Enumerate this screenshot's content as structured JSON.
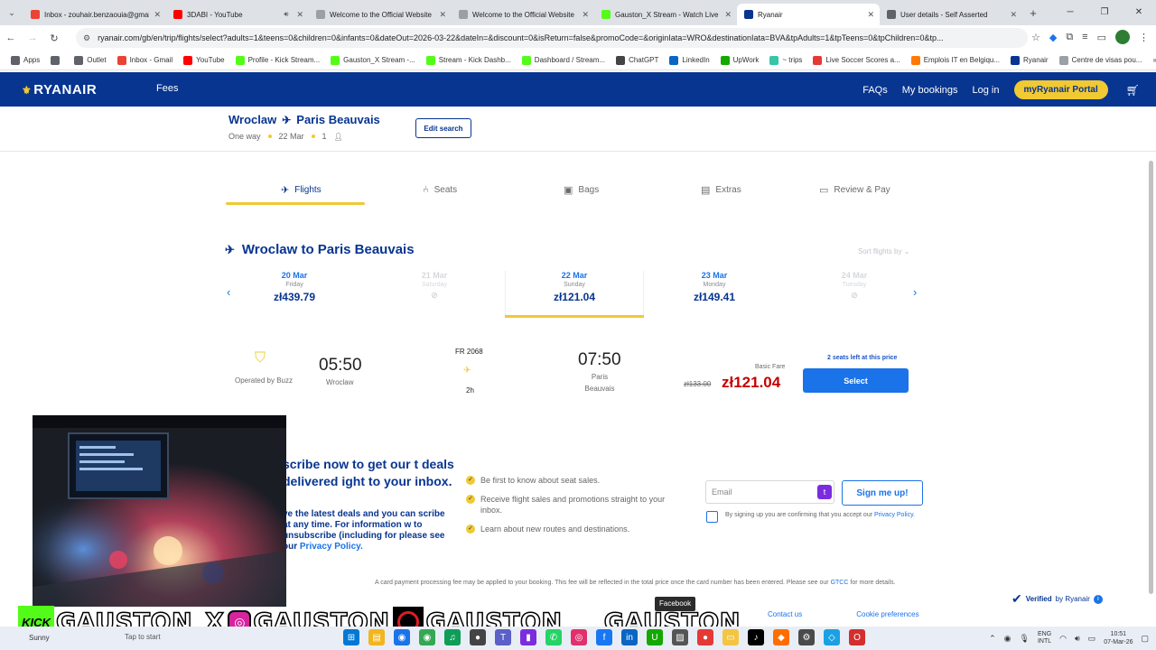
{
  "browser": {
    "tabs": [
      {
        "title": "Inbox - zouhair.benzaouia@gmail.com",
        "icon": "gmail-icon",
        "color": "#ea4335",
        "active": false
      },
      {
        "title": "3DABI - YouTube",
        "icon": "youtube-icon",
        "color": "#ff0000",
        "active": false,
        "muted": true
      },
      {
        "title": "Welcome to the Official Website",
        "icon": "bls-icon",
        "color": "#9aa0a6",
        "active": false
      },
      {
        "title": "Welcome to the Official Website",
        "icon": "bls-icon",
        "color": "#9aa0a6",
        "active": false
      },
      {
        "title": "Gauston_X Stream - Watch Live",
        "icon": "kick-icon",
        "color": "#53fc18",
        "active": false
      },
      {
        "title": "Ryanair",
        "icon": "ryanair-icon",
        "color": "#073590",
        "active": true
      },
      {
        "title": "User details - Self Asserted",
        "icon": "globe-icon",
        "color": "#5f6368",
        "active": false
      }
    ],
    "url": "ryanair.com/gb/en/trip/flights/select?adults=1&teens=0&children=0&infants=0&dateOut=2026-03-22&dateIn=&discount=0&isReturn=false&promoCode=&originIata=WRO&destinationIata=BVA&tpAdults=1&tpTeens=0&tpChildren=0&tp...",
    "bookmarks": [
      {
        "label": "Apps",
        "color": "#5f6368"
      },
      {
        "label": "",
        "color": "#5f6368"
      },
      {
        "label": "Outlet",
        "color": "#5f6368"
      },
      {
        "label": "Inbox - Gmail",
        "color": "#ea4335"
      },
      {
        "label": "YouTube",
        "color": "#ff0000"
      },
      {
        "label": "Profile - Kick Stream...",
        "color": "#53fc18"
      },
      {
        "label": "Gauston_X Stream -...",
        "color": "#53fc18"
      },
      {
        "label": "Stream - Kick Dashb...",
        "color": "#53fc18"
      },
      {
        "label": "Dashboard / Stream...",
        "color": "#53fc18"
      },
      {
        "label": "ChatGPT",
        "color": "#444444"
      },
      {
        "label": "LinkedIn",
        "color": "#0a66c2"
      },
      {
        "label": "UpWork",
        "color": "#14a800"
      },
      {
        "label": "~ trips",
        "color": "#36c5a8"
      },
      {
        "label": "Live Soccer Scores a...",
        "color": "#e53935"
      },
      {
        "label": "Emplois IT en Belgiqu...",
        "color": "#ff7a00"
      },
      {
        "label": "Ryanair",
        "color": "#073590"
      },
      {
        "label": "Centre de visas pou...",
        "color": "#9aa0a6"
      }
    ]
  },
  "header": {
    "logo": "RYANAIR",
    "fees": "Fees",
    "faqs": "FAQs",
    "bookings": "My bookings",
    "login": "Log in",
    "portal": "myRyanair Portal"
  },
  "trip": {
    "origin": "Wroclaw",
    "destination": "Paris Beauvais",
    "type": "One way",
    "date": "22 Mar",
    "passengers": "1",
    "edit": "Edit search"
  },
  "steps": [
    {
      "label": "Flights",
      "icon": "plane-icon",
      "active": true
    },
    {
      "label": "Seats",
      "icon": "seat-icon",
      "active": false
    },
    {
      "label": "Bags",
      "icon": "bag-icon",
      "active": false
    },
    {
      "label": "Extras",
      "icon": "extras-icon",
      "active": false
    },
    {
      "label": "Review & Pay",
      "icon": "card-icon",
      "active": false
    }
  ],
  "flights": {
    "heading": "Wroclaw to Paris Beauvais",
    "sort": "Sort flights by",
    "dates": [
      {
        "date": "20 Mar",
        "day": "Friday",
        "price": "zł439.79",
        "available": true,
        "selected": false
      },
      {
        "date": "21 Mar",
        "day": "Saturday",
        "price": "",
        "available": false,
        "selected": false
      },
      {
        "date": "22 Mar",
        "day": "Sunday",
        "price": "zł121.04",
        "available": true,
        "selected": true
      },
      {
        "date": "23 Mar",
        "day": "Monday",
        "price": "zł149.41",
        "available": true,
        "selected": false
      },
      {
        "date": "24 Mar",
        "day": "Tuesday",
        "price": "",
        "available": false,
        "selected": false
      }
    ],
    "card": {
      "operator": "Operated by Buzz",
      "dep_time": "05:50",
      "dep_city": "Wroclaw",
      "flight_no": "FR 2068",
      "duration": "2h",
      "arr_time": "07:50",
      "arr_city": "Paris Beauvais",
      "fare_label": "Basic Fare",
      "old_price": "zł133.00",
      "price": "zł121.04",
      "seats_left": "2 seats left at this price",
      "select": "Select"
    }
  },
  "newsletter": {
    "heading": "scribe now to get our t deals delivered ight to your inbox.",
    "body": "ve the latest deals and you can scribe at any time. For information w to unsubscribe (including for please see our",
    "privacy": "Privacy Policy.",
    "bullets": [
      "Be first to know about seat sales.",
      "Receive flight sales and promotions straight to your inbox.",
      "Learn about new routes and destinations."
    ],
    "email_placeholder": "Email",
    "signup": "Sign me up!",
    "consent": "By signing up you are confirming that you accept our",
    "consent_link": "Privacy Policy."
  },
  "footer": {
    "note": "A card payment processing fee may be applied to your booking. This fee will be reflected in the total price once the card number has been entered. Please see our",
    "note_link": "GTCC",
    "note_tail": "for more details.",
    "verified": "Verified",
    "verified_by": "by Ryanair",
    "contact": "Contact us",
    "cookies": "Cookie preferences"
  },
  "overlay": {
    "tooltip": "Facebook",
    "kick": "KICK",
    "handle1": "GAUSTON_X",
    "handle2": "GAUSTON",
    "handle3": "GAUSTON",
    "tiktok": "TikTok",
    "handle4": "GAUSTON"
  },
  "taskbar": {
    "weather": "Sunny",
    "search": "Tap to start",
    "lang": "ENG",
    "lang2": "INTL",
    "time": "10:51",
    "date": "07-Mar-26"
  }
}
